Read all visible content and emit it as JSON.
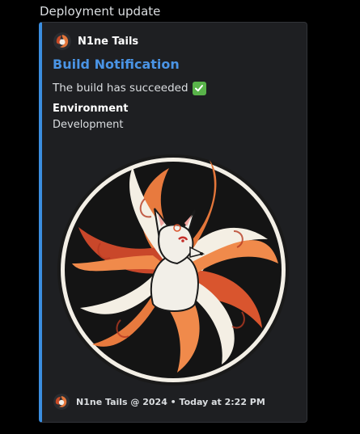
{
  "message": {
    "text": "Deployment update"
  },
  "embed": {
    "accent_color": "#3b8ee0",
    "author": {
      "name": "N1ne Tails",
      "icon": "nine-tailed-fox-avatar-icon"
    },
    "title": "Build Notification",
    "description": "The build has succeeded",
    "description_icon": "white-check-mark-icon",
    "fields": [
      {
        "name": "Environment",
        "value": "Development"
      }
    ],
    "image": "nine-tailed-fox-image",
    "footer": {
      "text": "N1ne Tails @ 2024 • Today at 2:22 PM",
      "icon": "nine-tailed-fox-avatar-icon"
    }
  }
}
